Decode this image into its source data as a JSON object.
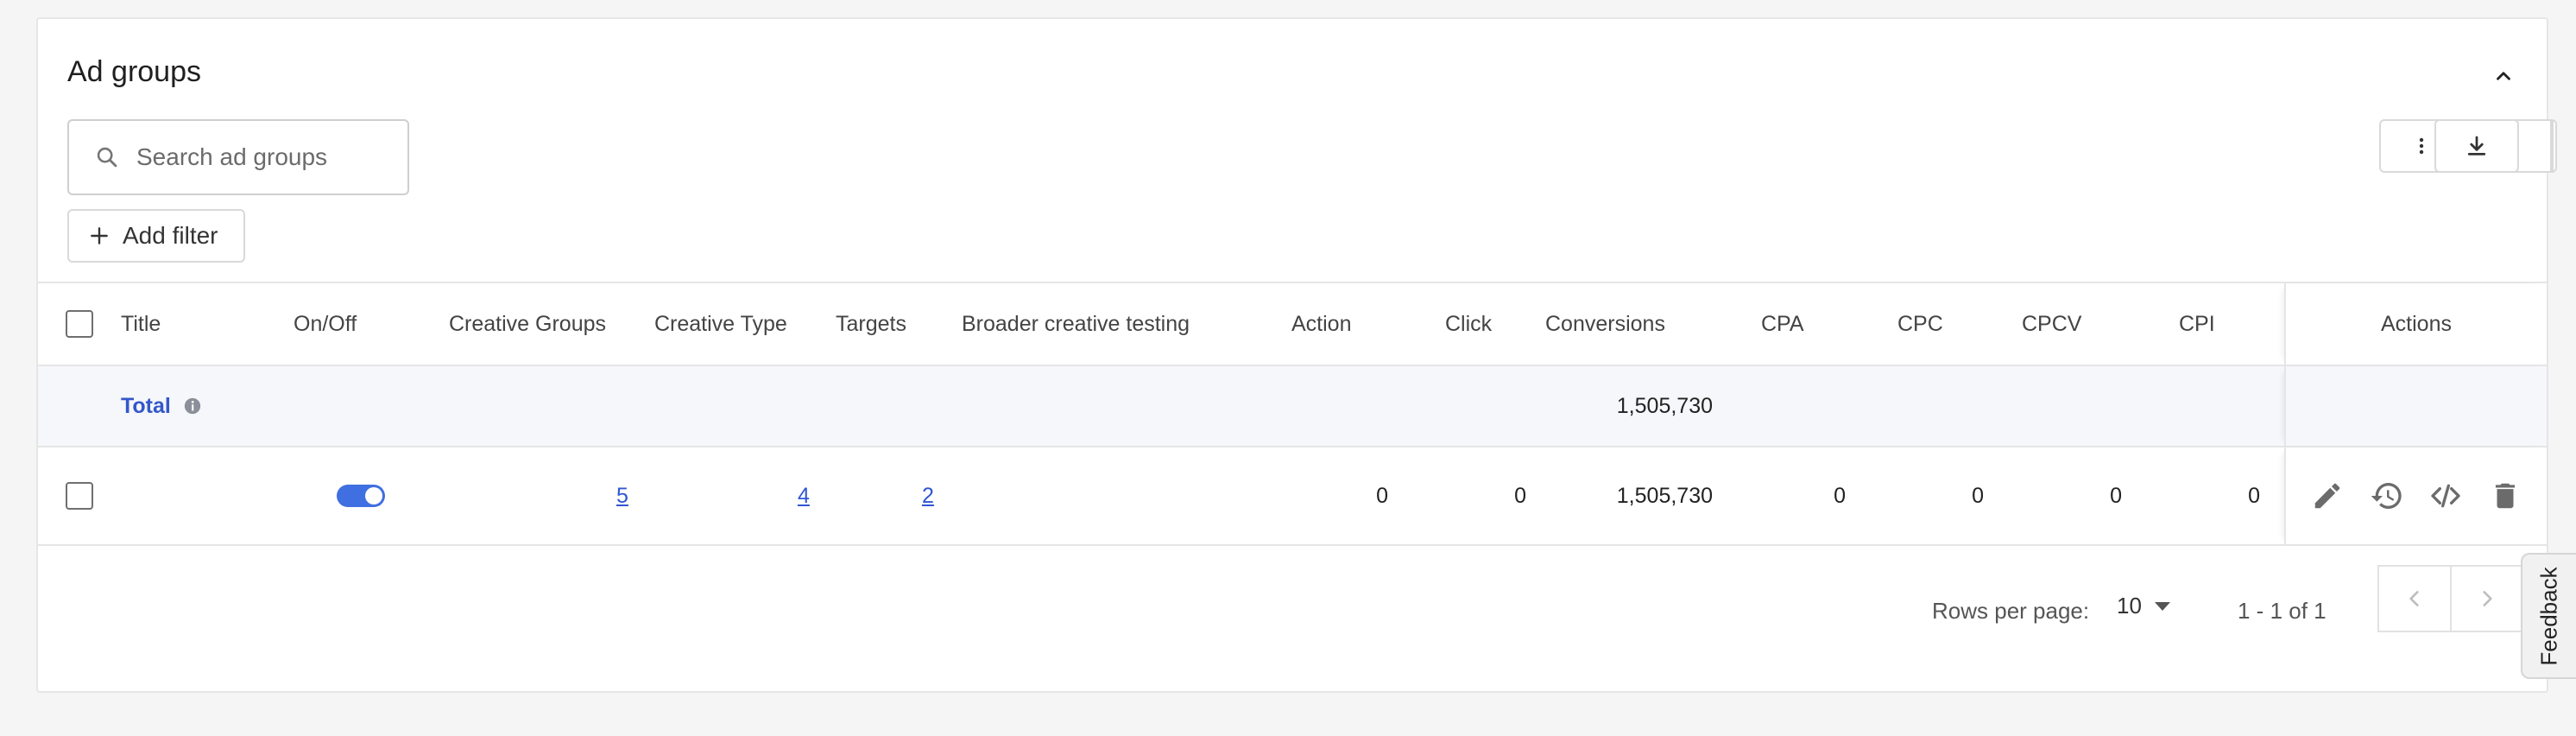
{
  "section": {
    "title": "Ad groups"
  },
  "search": {
    "placeholder": "Search ad groups",
    "value": ""
  },
  "filter": {
    "add_label": "Add filter"
  },
  "toolbar": {
    "icons": [
      "more-vert-icon",
      "gear-icon",
      "download-icon"
    ]
  },
  "table": {
    "columns": {
      "title": "Title",
      "onoff": "On/Off",
      "creative_groups": "Creative Groups",
      "creative_type": "Creative Type",
      "targets": "Targets",
      "broader": "Broader creative testing",
      "action": "Action",
      "click": "Click",
      "conversions": "Conversions",
      "cpa": "CPA",
      "cpc": "CPC",
      "cpcv": "CPCV",
      "cpi": "CPI",
      "actions": "Actions"
    },
    "total": {
      "label": "Total",
      "conversions": "1,505,730"
    },
    "rows": [
      {
        "title": "",
        "enabled": true,
        "creative_groups": "5",
        "creative_type": "4",
        "targets": "2",
        "action": "0",
        "click": "0",
        "conversions": "1,505,730",
        "cpa": "0",
        "cpc": "0",
        "cpcv": "0",
        "cpi": "0"
      }
    ],
    "row_actions": [
      "edit-icon",
      "history-icon",
      "code-icon",
      "delete-icon"
    ]
  },
  "pagination": {
    "rows_per_page_label": "Rows per page:",
    "rows_per_page": "10",
    "range": "1 - 1 of 1"
  },
  "feedback": {
    "label": "Feedback"
  },
  "colors": {
    "accent": "#3f6fe0",
    "link": "#3056d3",
    "total_bg": "#f6f7fb"
  }
}
